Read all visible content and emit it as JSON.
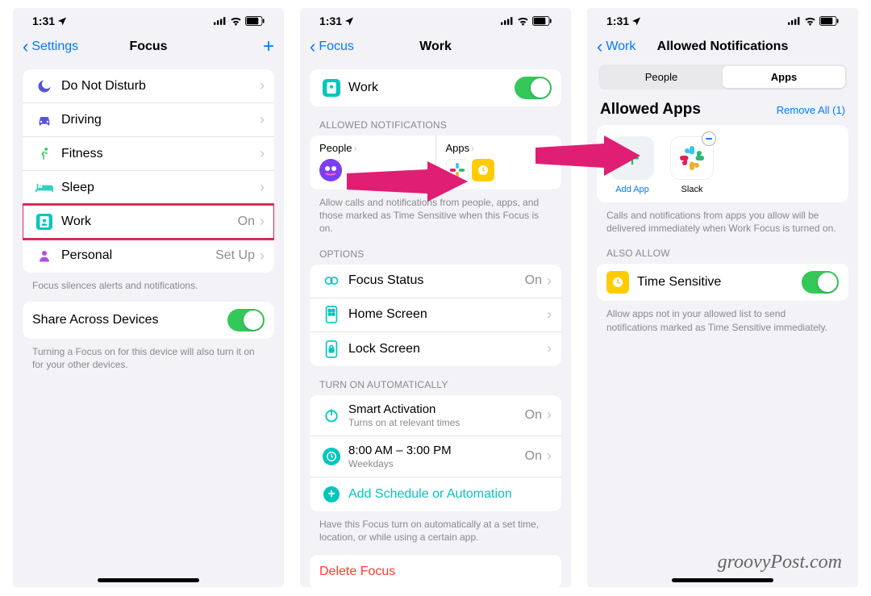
{
  "status": {
    "time": "1:31"
  },
  "screen1": {
    "back": "Settings",
    "title": "Focus",
    "items": [
      {
        "label": "Do Not Disturb",
        "icon": "moon",
        "color": "#5856d6",
        "value": ""
      },
      {
        "label": "Driving",
        "icon": "car",
        "color": "#5856d6",
        "value": ""
      },
      {
        "label": "Fitness",
        "icon": "run",
        "color": "#34c759",
        "value": ""
      },
      {
        "label": "Sleep",
        "icon": "bed",
        "color": "#34c759",
        "value": ""
      },
      {
        "label": "Work",
        "icon": "badge",
        "color": "#00c7be",
        "value": "On"
      },
      {
        "label": "Personal",
        "icon": "person",
        "color": "#af52de",
        "value": "Set Up"
      }
    ],
    "footnote1": "Focus silences alerts and notifications.",
    "share_label": "Share Across Devices",
    "footnote2": "Turning a Focus on for this device will also turn it on for your other devices."
  },
  "screen2": {
    "back": "Focus",
    "title": "Work",
    "work_label": "Work",
    "allowed_header": "ALLOWED NOTIFICATIONS",
    "people_label": "People",
    "apps_label": "Apps",
    "allowed_footnote": "Allow calls and notifications from people, apps, and those marked as Time Sensitive when this Focus is on.",
    "options_header": "OPTIONS",
    "focus_status": "Focus Status",
    "focus_status_val": "On",
    "home_screen": "Home Screen",
    "lock_screen": "Lock Screen",
    "auto_header": "TURN ON AUTOMATICALLY",
    "smart_activation": "Smart Activation",
    "smart_sub": "Turns on at relevant times",
    "smart_val": "On",
    "schedule_time": "8:00 AM – 3:00 PM",
    "schedule_sub": "Weekdays",
    "schedule_val": "On",
    "add_schedule": "Add Schedule or Automation",
    "auto_footnote": "Have this Focus turn on automatically at a set time, location, or while using a certain app.",
    "delete": "Delete Focus"
  },
  "screen3": {
    "back": "Work",
    "title": "Allowed Notifications",
    "seg_people": "People",
    "seg_apps": "Apps",
    "allowed_apps": "Allowed Apps",
    "remove_all": "Remove All (1)",
    "add_app": "Add App",
    "slack": "Slack",
    "apps_footnote": "Calls and notifications from apps you allow will be delivered immediately when Work Focus is turned on.",
    "also_allow": "ALSO ALLOW",
    "time_sensitive": "Time Sensitive",
    "ts_footnote": "Allow apps not in your allowed list to send notifications marked as Time Sensitive immediately."
  },
  "watermark": "groovyPost.com"
}
